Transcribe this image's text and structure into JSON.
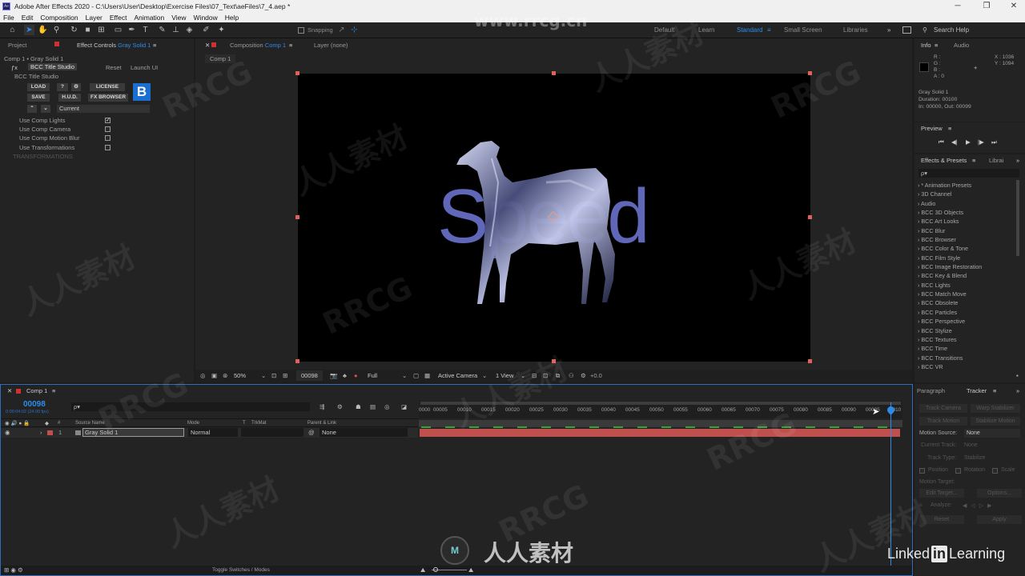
{
  "window": {
    "title": "Adobe After Effects 2020 - C:\\Users\\User\\Desktop\\Exercise Files\\07_Text\\aeFiles\\7_4.aep *",
    "icon_label": "Ae",
    "controls": [
      "─",
      "❐",
      "✕"
    ]
  },
  "menu": [
    "File",
    "Edit",
    "Composition",
    "Layer",
    "Effect",
    "Animation",
    "View",
    "Window",
    "Help"
  ],
  "toolbar": {
    "snapping_label": "Snapping",
    "workspaces": [
      "Default",
      "Learn",
      "Standard",
      "Small Screen",
      "Libraries"
    ],
    "active_workspace": "Standard",
    "search_help": "Search Help"
  },
  "left_panel": {
    "tabs": [
      "Project",
      "Effect Controls Gray Solid 1"
    ],
    "effect_controls_prefix": "Effect Controls",
    "effect_controls_layer": "Gray Solid 1",
    "breadcrumb": "Comp 1 • Gray Solid 1",
    "effect_name": "BCC Title Studio",
    "reset_label": "Reset",
    "launch_ui_label": "Launch UI",
    "group_name": "BCC Title Studio",
    "buttons": {
      "load": "LOAD",
      "help": "?",
      "license": "LICENSE",
      "save": "SAVE",
      "hud": "H.U.D.",
      "fx_browser": "FX BROWSER"
    },
    "logo_letter": "B",
    "preset_value": "Current",
    "options": [
      {
        "label": "Use Comp Lights",
        "checked": true
      },
      {
        "label": "Use Comp Camera",
        "checked": false
      },
      {
        "label": "Use Comp Motion Blur",
        "checked": false
      },
      {
        "label": "Use Transformations",
        "checked": false
      }
    ],
    "transformations_label": "TRANSFORMATIONS"
  },
  "composition": {
    "tab_prefix": "Composition",
    "tab_name": "Comp 1",
    "layer_tab": "Layer (none)",
    "comp_button": "Comp 1",
    "viewer_text": "Speed",
    "footer": {
      "zoom": "50%",
      "timecode": "00098",
      "resolution": "Full",
      "camera": "Active Camera",
      "views": "1 View",
      "exposure": "+0.0"
    }
  },
  "info_panel": {
    "tabs": [
      "Info",
      "Audio"
    ],
    "channels": [
      "R :",
      "G :",
      "B :",
      "A : 0"
    ],
    "x": "X : 1036",
    "y": "Y : 1094",
    "layer": "Gray Solid 1",
    "duration": "Duration: 00100",
    "in_out": "In: 00000, Out: 00099"
  },
  "preview_panel": {
    "title": "Preview",
    "controls": [
      "⏮",
      "◀|",
      "▶",
      "|▶",
      "⏭"
    ]
  },
  "effects_panel": {
    "tabs": [
      "Effects & Presets",
      "Librai"
    ],
    "search_placeholder": "ρ▾",
    "items": [
      "* Animation Presets",
      "3D Channel",
      "Audio",
      "BCC 3D Objects",
      "BCC Art Looks",
      "BCC Blur",
      "BCC Browser",
      "BCC Color & Tone",
      "BCC Film Style",
      "BCC Image Restoration",
      "BCC Key & Blend",
      "BCC Lights",
      "BCC Match Move",
      "BCC Obsolete",
      "BCC Particles",
      "BCC Perspective",
      "BCC Stylize",
      "BCC Textures",
      "BCC Time",
      "BCC Transitions",
      "BCC VR"
    ]
  },
  "tracker_panel": {
    "tabs": [
      "Paragraph",
      "Tracker"
    ],
    "track_camera": "Track Camera",
    "warp_stabilizer": "Warp Stabilizer",
    "track_motion": "Track Motion",
    "stabilize_motion": "Stabilize Motion",
    "motion_source_label": "Motion Source:",
    "motion_source_value": "None",
    "current_track_label": "Current Track:",
    "current_track_value": "None",
    "track_type_label": "Track Type:",
    "track_type_value": "Stabilize",
    "position": "Position",
    "rotation": "Rotation",
    "scale": "Scale",
    "motion_target": "Motion Target:",
    "edit_target": "Edit Target...",
    "options": "Options...",
    "analyze": "Analyze:",
    "reset": "Reset",
    "apply": "Apply"
  },
  "timeline": {
    "tab": "Comp 1",
    "current_time": "00098",
    "fps_info": "0:00:04:02 (24.00 fps)",
    "search_placeholder": "ρ▾",
    "columns": {
      "source_name": "Source Name",
      "mode": "Mode",
      "t": "T",
      "trkmat": "TrkMat",
      "parent_link": "Parent & Link"
    },
    "layers": [
      {
        "number": "1",
        "name": "Gray Solid 1",
        "mode": "Normal",
        "parent": "None",
        "color": "#c0504d"
      }
    ],
    "ruler": [
      "0000",
      "00005",
      "00010",
      "00015",
      "00020",
      "00025",
      "00030",
      "00035",
      "00040",
      "00045",
      "00050",
      "00055",
      "00060",
      "00065",
      "00070",
      "00075",
      "00080",
      "00085",
      "00090",
      "00095",
      "0010"
    ],
    "toggle_label": "Toggle Switches / Modes",
    "playhead_frame": 98,
    "total_frames": 100
  },
  "watermarks": {
    "rrcg": "RRCG",
    "cn": "人人素材",
    "site": "www.rrcg.cn"
  },
  "branding": {
    "bottom_logo_text": "人人素材",
    "linkedin_prefix": "Linked",
    "linkedin_in": "in",
    "linkedin_suffix": "Learning"
  }
}
